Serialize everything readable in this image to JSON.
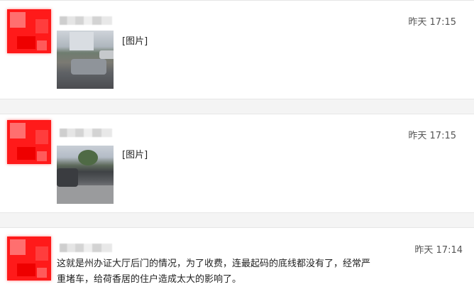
{
  "posts": [
    {
      "name": "",
      "time": "昨天 17:15",
      "image_label": "[图片]"
    },
    {
      "name": "",
      "time": "昨天 17:15",
      "image_label": "[图片]"
    },
    {
      "name": "",
      "time": "昨天 17:14",
      "text_line1": "这就是州办证大厅后门的情况，为了收费，连最起码的底线都没有了，经常严",
      "text_line2": "重堵车，给荷香居的住户造成太大的影响了。"
    }
  ],
  "colors": {
    "avatar_red": "#ff1a1a",
    "separator": "#f4f4f4",
    "time_gray": "#555555"
  },
  "icons": [
    "avatar-pixelated",
    "photo-thumbnail"
  ]
}
